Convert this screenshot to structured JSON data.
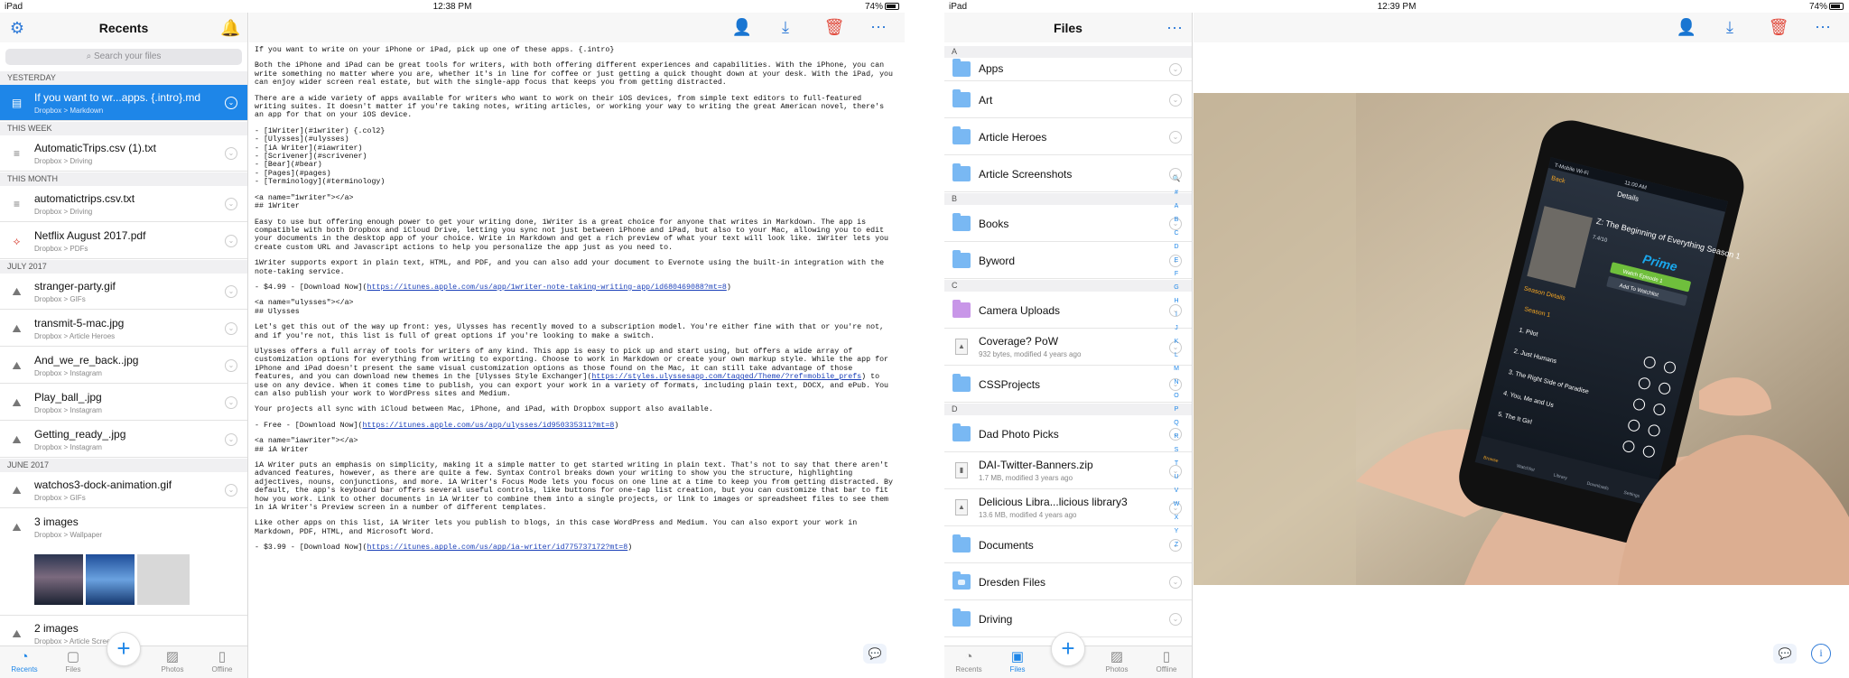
{
  "left": {
    "status": {
      "device": "iPad",
      "time": "12:38 PM",
      "battery": "74%"
    },
    "sidebar": {
      "title": "Recents",
      "search_placeholder": "Search your files",
      "sections": {
        "yesterday": "YESTERDAY",
        "this_week": "THIS WEEK",
        "this_month": "THIS MONTH",
        "july": "JULY 2017",
        "june": "JUNE 2017"
      },
      "items": [
        {
          "name": "If you want to wr...apps. {.intro}.md",
          "path": "Dropbox > Markdown"
        },
        {
          "name": "AutomaticTrips.csv (1).txt",
          "path": "Dropbox > Driving"
        },
        {
          "name": "automatictrips.csv.txt",
          "path": "Dropbox > Driving"
        },
        {
          "name": "Netflix August 2017.pdf",
          "path": "Dropbox > PDFs"
        },
        {
          "name": "stranger-party.gif",
          "path": "Dropbox > GIFs"
        },
        {
          "name": "transmit-5-mac.jpg",
          "path": "Dropbox > Article Heroes"
        },
        {
          "name": "And_we_re_back..jpg",
          "path": "Dropbox > Instagram"
        },
        {
          "name": "Play_ball_.jpg",
          "path": "Dropbox > Instagram"
        },
        {
          "name": "Getting_ready_.jpg",
          "path": "Dropbox > Instagram"
        },
        {
          "name": "watchos3-dock-animation.gif",
          "path": "Dropbox > GIFs"
        },
        {
          "name": "3 images",
          "path": "Dropbox > Wallpaper"
        },
        {
          "name": "2 images",
          "path": "Dropbox > Article Screenshots"
        }
      ]
    },
    "tabs": [
      "Recents",
      "Files",
      "Photos",
      "Offline"
    ],
    "editor": {
      "lines": {
        "l1": "If you want to write on your iPhone or iPad, pick up one of these apps. {.intro}",
        "p1": "Both the iPhone and iPad can be great tools for writers, with both offering different experiences and capabilities. With the iPhone, you can write something no matter where you are, whether it's in line for coffee or just getting a quick thought down at your desk. With the iPad, you can enjoy wider screen real estate, but with the single-app focus that keeps you from getting distracted.",
        "p2": "There are a wide variety of apps available for writers who want to work on their iOS devices, from simple text editors to full-featured writing suites. It doesn't matter if you're taking notes, writing articles, or working your way to writing the great American novel, there's an app for that on your iOS device.",
        "list": "- [1Writer](#1writer) {.col2}\n- [Ulysses](#ulysses)\n- [iA Writer](#iawriter)\n- [Scrivener](#scrivener)\n- [Bear](#bear)\n- [Pages](#pages)\n- [Terminology](#terminology)",
        "h1": "<a name=\"1writer\"></a>\n## 1Writer",
        "p3": "Easy to use but offering enough power to get your writing done, 1Writer is a great choice for anyone that writes in Markdown. The app is compatible with both Dropbox and iCloud Drive, letting you sync not just between iPhone and iPad, but also to your Mac, allowing you to edit your documents in the desktop app of your choice. Write in Markdown and get a rich preview of what your text will look like. 1Writer lets you create custom URL and Javascript actions to help you personalize the app just as you need to.",
        "p4": "1Writer supports export in plain text, HTML, and PDF, and you can also add your document to Evernote using the built-in integration with the note-taking service.",
        "p5a": "- $4.99 - [Download Now](",
        "p5u": "https://itunes.apple.com/us/app/1writer-note-taking-writing-app/id680469088?mt=8",
        "p5b": ")",
        "h2": "<a name=\"ulysses\"></a>\n## Ulysses",
        "p6": "Let's get this out of the way up front: yes, Ulysses has recently moved to a subscription model. You're either fine with that or you're not, and if you're not, this list is full of great options if you're looking to make a switch.",
        "p7a": "Ulysses offers a full array of tools for writers of any kind. This app is easy to pick up and start using, but offers a wide array of customization options for everything from writing to exporting. Choose to work in Markdown or create your own markup style. While the app for iPhone and iPad doesn't present the same visual customization options as those found on the Mac, it can still take advantage of those features, and you can download new themes in the [Ulysses Style Exchanger](",
        "p7u": "https://styles.ulyssesapp.com/tagged/Theme/?ref=mobile_prefs",
        "p7b": ") to use on any device. When it comes time to publish, you can export your work in a variety of formats, including plain text, DOCX, and ePub. You can also publish your work to WordPress sites and Medium.",
        "p8": "Your projects all sync with iCloud between Mac, iPhone, and iPad, with Dropbox support also available.",
        "p9a": "- Free - [Download Now](",
        "p9u": "https://itunes.apple.com/us/app/ulysses/id950335311?mt=8",
        "p9b": ")",
        "h3": "<a name=\"iawriter\"></a>\n## iA Writer",
        "p10": "iA Writer puts an emphasis on simplicity, making it a simple matter to get started writing in plain text. That's not to say that there aren't advanced features, however, as there are quite a few. Syntax Control breaks down your writing to show you the structure, highlighting adjectives, nouns, conjunctions, and more. iA Writer's Focus Mode lets you focus on one line at a time to keep you from getting distracted. By default, the app's keyboard bar offers several useful controls, like buttons for one-tap list creation, but you can customize that bar to fit how you work. Link to other documents in iA Writer to combine them into a single projects, or link to images or spreadsheet files to see them in iA Writer's Preview screen in a number of different templates.",
        "p11": "Like other apps on this list, iA Writer lets you publish to blogs, in this case WordPress and Medium. You can also export your work in Markdown, PDF, HTML, and Microsoft Word.",
        "p12a": "- $3.99 - [Download Now](",
        "p12u": "https://itunes.apple.com/us/app/ia-writer/id775737172?mt=8",
        "p12b": ")"
      }
    }
  },
  "right": {
    "status": {
      "device": "iPad",
      "time": "12:39 PM",
      "battery": "74%"
    },
    "files": {
      "title": "Files",
      "sections": {
        "a": "A",
        "b": "B",
        "c": "C",
        "d": "D"
      },
      "items": [
        {
          "name": "Apps"
        },
        {
          "name": "Art"
        },
        {
          "name": "Article Heroes"
        },
        {
          "name": "Article Screenshots"
        },
        {
          "name": "Books"
        },
        {
          "name": "Byword"
        },
        {
          "name": "Camera Uploads"
        },
        {
          "name": "Coverage? PoW",
          "meta": "932 bytes, modified 4 years ago"
        },
        {
          "name": "CSSProjects"
        },
        {
          "name": "Dad Photo Picks"
        },
        {
          "name": "DAI-Twitter-Banners.zip",
          "meta": "1.7 MB, modified 3 years ago"
        },
        {
          "name": "Delicious Libra...licious library3",
          "meta": "13.6 MB, modified 4 years ago"
        },
        {
          "name": "Documents"
        },
        {
          "name": "Dresden Files"
        },
        {
          "name": "Driving"
        }
      ],
      "index": [
        "🔍",
        "#",
        "A",
        "B",
        "C",
        "D",
        "E",
        "F",
        "G",
        "H",
        "I",
        "J",
        "K",
        "L",
        "M",
        "N",
        "O",
        "P",
        "Q",
        "R",
        "S",
        "T",
        "U",
        "V",
        "W",
        "X",
        "Y",
        "Z"
      ]
    },
    "tabs": [
      "Recents",
      "Files",
      "Photos",
      "Offline"
    ],
    "phone": {
      "carrier": "T-Mobile Wi-Fi",
      "time": "11:00 AM",
      "back": "Back",
      "header": "Details",
      "show_title": "Z: The Beginning of Everything Season 1",
      "rating": "7.4/10",
      "brand": "Prime",
      "watch": "Watch Episode 1",
      "watchlist": "Add To Watchlist",
      "season_details": "Season Details",
      "season": "Season 1",
      "episodes": [
        "1. Pilot",
        "2. Just Humans",
        "3. The Right Side of Paradise",
        "4. You, Me and Us",
        "5. The It Girl"
      ],
      "tabs": [
        "Browse",
        "Watchlist",
        "Library",
        "Downloads",
        "Settings"
      ]
    }
  }
}
